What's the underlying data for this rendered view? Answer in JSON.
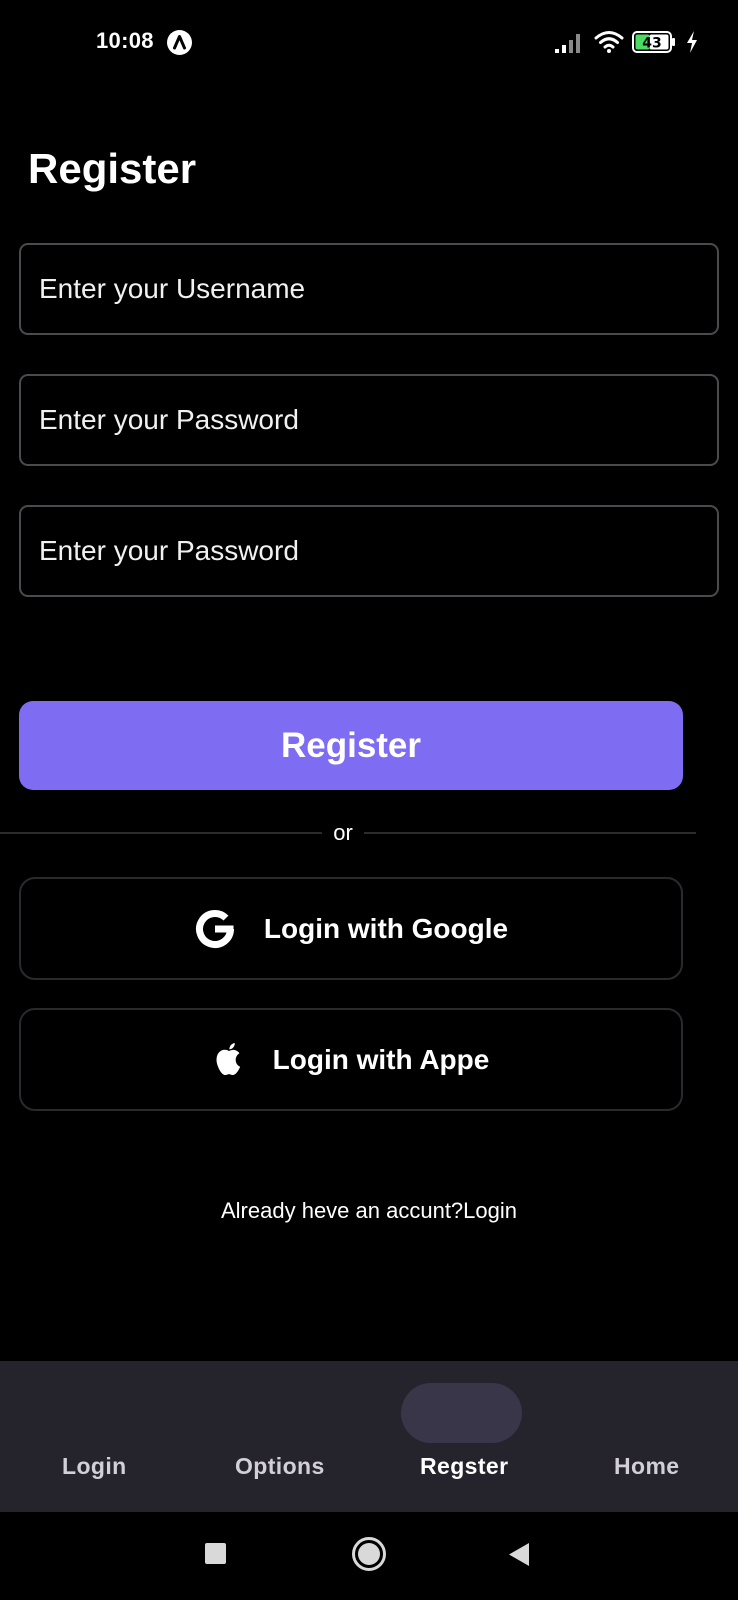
{
  "status_bar": {
    "time": "10:08",
    "battery_level": "43",
    "icons": [
      "app-badge-icon",
      "signal-icon",
      "wifi-icon",
      "battery-icon",
      "charging-icon"
    ]
  },
  "page": {
    "title": "Register"
  },
  "form": {
    "username_placeholder": "Enter your Username",
    "password_placeholder": "Enter your Password",
    "confirm_password_placeholder": "Enter your Password",
    "username_value": "",
    "password_value": "",
    "confirm_password_value": "",
    "submit_label": "Register"
  },
  "divider": {
    "text": "or"
  },
  "social": {
    "google_label": "Login with Google",
    "google_icon": "google-icon",
    "apple_label": "Login with Appe",
    "apple_icon": "apple-icon"
  },
  "footer": {
    "login_prompt": "Already heve an accunt?Login"
  },
  "bottom_nav": {
    "items": [
      {
        "label": "Login",
        "active": false
      },
      {
        "label": "Options",
        "active": false
      },
      {
        "label": "Regster",
        "active": true
      },
      {
        "label": "Home",
        "active": false
      }
    ]
  },
  "system_nav": {
    "icons": [
      "recents-icon",
      "home-icon",
      "back-icon"
    ]
  },
  "colors": {
    "background": "#000000",
    "accent": "#7e6cf2",
    "nav_background": "#25232b",
    "nav_active_indicator": "#39364a",
    "field_border": "#4a4a4f"
  }
}
